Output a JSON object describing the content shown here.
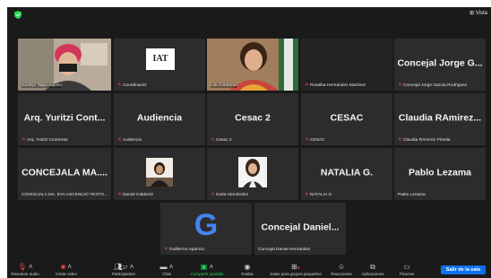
{
  "topbar": {
    "view_label": "Vista"
  },
  "tiles": [
    {
      "label": "Jocelyn Tapia Aquino",
      "kind": "video"
    },
    {
      "label": "CoordinaciO",
      "kind": "logo",
      "logo_text": "IAT"
    },
    {
      "label": "Lila Contreras",
      "kind": "video"
    },
    {
      "label": "Rosalba Hernández Martínez",
      "kind": "blank"
    },
    {
      "name": "Concejal Jorge G...",
      "label": "Concejal Jorge García Rodríguez"
    },
    {
      "name": "Arq. Yuritzi Cont...",
      "label": "Arq. Yuritzi Contreras"
    },
    {
      "name": "Audiencia",
      "label": "Audiencia"
    },
    {
      "name": "Cesac 2",
      "label": "Cesac 2"
    },
    {
      "name": "CESAC",
      "label": "CESAC"
    },
    {
      "name": "Claudia RAmirez...",
      "label": "Claudia RAmírez Pineda"
    },
    {
      "name": "CONCEJALA MA....",
      "label": "CONCEJALA MA. EVA ASCENCIO TEXTO..."
    },
    {
      "label": "Daniel Calderón",
      "kind": "photo"
    },
    {
      "label": "Karla Hernández",
      "kind": "photo"
    },
    {
      "name": "NATALIA G.",
      "label": "NATALIA G."
    },
    {
      "name": "Pablo Lezama",
      "label": "Pablo Lezama"
    },
    {
      "label": "Guillermo Aparicio",
      "kind": "google",
      "logo_text": "G"
    },
    {
      "name": "Concejal Daniel...",
      "label": "Concejal Daniel Hernández"
    }
  ],
  "toolbar": {
    "items": [
      {
        "label": "Reactivar audio",
        "icon": "mic-muted-icon"
      },
      {
        "label": "Iniciar video",
        "icon": "video-off-icon"
      },
      {
        "label": "Participantes",
        "icon": "participants-icon",
        "count": "17"
      },
      {
        "label": "Chat",
        "icon": "chat-icon"
      },
      {
        "label": "Compartir pantalla",
        "icon": "share-screen-icon"
      },
      {
        "label": "Grabar",
        "icon": "record-icon"
      },
      {
        "label": "Salas para grupos pequeños",
        "icon": "breakout-rooms-icon"
      },
      {
        "label": "Reacciones",
        "icon": "reactions-icon"
      },
      {
        "label": "Aplicaciones",
        "icon": "apps-icon"
      },
      {
        "label": "Pizarras",
        "icon": "whiteboard-icon"
      }
    ],
    "leave_label": "Salir de la sala"
  },
  "colors": {
    "active_speaker": "#c9d34a",
    "share_green": "#23d959",
    "leave_blue": "#0e71eb",
    "muted_red": "#e54848"
  }
}
